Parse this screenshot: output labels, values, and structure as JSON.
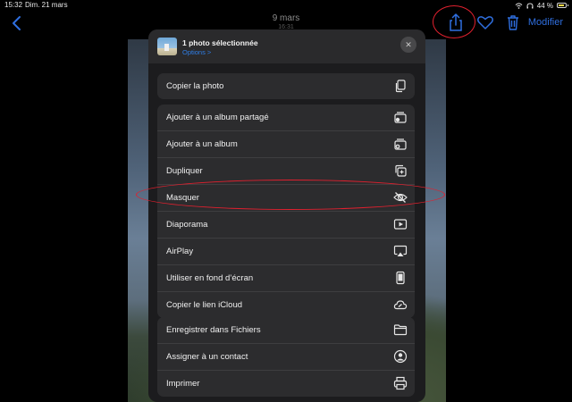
{
  "status_bar": {
    "time": "15:32",
    "date": "Dim. 21 mars",
    "battery": "44 %"
  },
  "nav": {
    "date": "9 mars",
    "time": "16:31",
    "modify": "Modifier"
  },
  "sheet": {
    "title": "1 photo sélectionnée",
    "options": "Options >",
    "group1": [
      {
        "label": "Copier la photo",
        "icon": "copy-icon"
      }
    ],
    "group2": [
      {
        "label": "Ajouter à un album partagé",
        "icon": "shared-album-icon"
      },
      {
        "label": "Ajouter à un album",
        "icon": "add-album-icon"
      },
      {
        "label": "Dupliquer",
        "icon": "duplicate-icon"
      },
      {
        "label": "Masquer",
        "icon": "hide-eye-icon"
      },
      {
        "label": "Diaporama",
        "icon": "slideshow-icon"
      },
      {
        "label": "AirPlay",
        "icon": "airplay-icon"
      },
      {
        "label": "Utiliser en fond d’écran",
        "icon": "wallpaper-icon"
      },
      {
        "label": "Copier le lien iCloud",
        "icon": "icloud-link-icon"
      }
    ],
    "group3": [
      {
        "label": "Enregistrer dans Fichiers",
        "icon": "folder-icon"
      },
      {
        "label": "Assigner à un contact",
        "icon": "contact-icon"
      },
      {
        "label": "Imprimer",
        "icon": "printer-icon"
      }
    ]
  },
  "colors": {
    "accent": "#2f6fe0",
    "annotation": "#e0202e",
    "sheet_bg": "#1c1c1e",
    "row_bg": "#2c2c2e"
  }
}
